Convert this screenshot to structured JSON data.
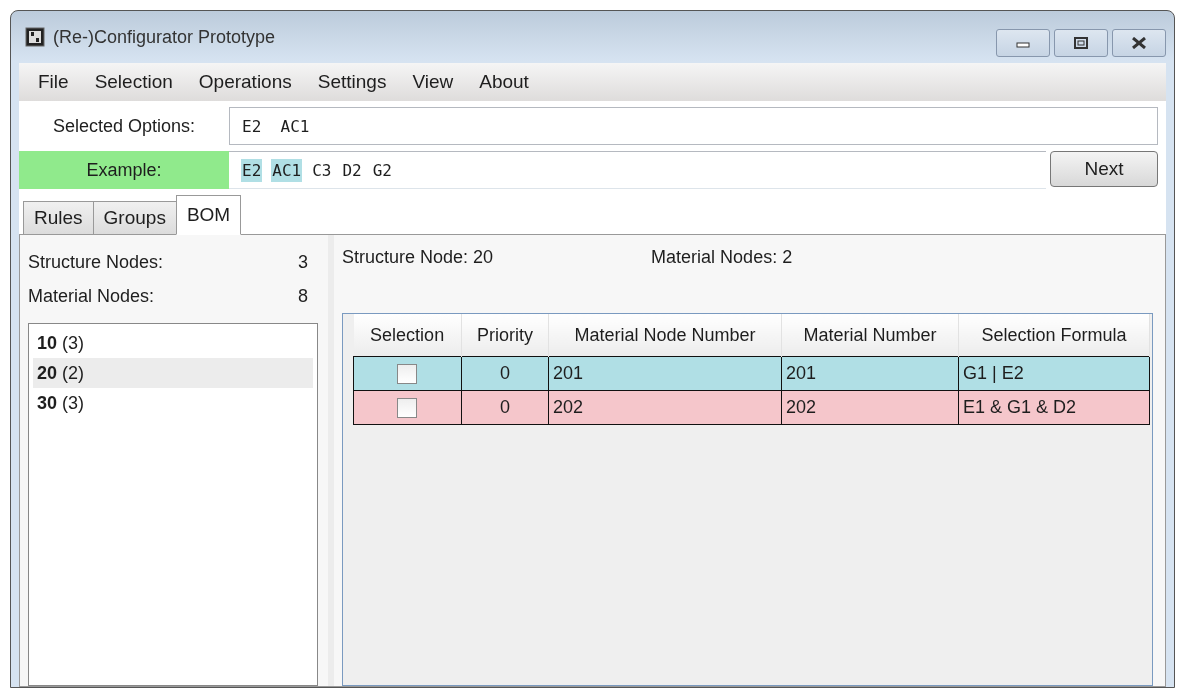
{
  "window": {
    "title": "(Re-)Configurator Prototype"
  },
  "menu": [
    "File",
    "Selection",
    "Operations",
    "Settings",
    "View",
    "About"
  ],
  "selected_options": {
    "label": "Selected Options:",
    "value": "E2  AC1"
  },
  "example": {
    "label": "Example:",
    "tokens": [
      {
        "text": "E2",
        "highlighted": true
      },
      {
        "text": "AC1",
        "highlighted": true
      },
      {
        "text": "C3",
        "highlighted": false
      },
      {
        "text": "D2",
        "highlighted": false
      },
      {
        "text": "G2",
        "highlighted": false
      }
    ],
    "button": "Next"
  },
  "tabs": [
    {
      "label": "Rules",
      "selected": false
    },
    {
      "label": "Groups",
      "selected": false
    },
    {
      "label": "BOM",
      "selected": true
    }
  ],
  "summary": [
    {
      "label": "Structure Nodes:",
      "value": "3"
    },
    {
      "label": "Material Nodes:",
      "value": "8"
    }
  ],
  "structure_list": [
    {
      "text": "**10** (3)",
      "selected": false
    },
    {
      "text": "**20** (2)",
      "selected": true
    },
    {
      "text": "**30** (3)",
      "selected": false
    }
  ],
  "detail": {
    "structure_node": "Structure Node: 20",
    "material_nodes": "Material Nodes: 2"
  },
  "table": {
    "columns": [
      "Selection",
      "Priority",
      "Material Node Number",
      "Material Number",
      "Selection Formula"
    ],
    "rows": [
      {
        "checked": false,
        "priority": "0",
        "node": "201",
        "material": "201",
        "formula": "G1 | E2",
        "color": "#b0dfe5"
      },
      {
        "checked": false,
        "priority": "0",
        "node": "202",
        "material": "202",
        "formula": "E1 & G1 & D2",
        "color": "#f5c6cb"
      }
    ]
  }
}
